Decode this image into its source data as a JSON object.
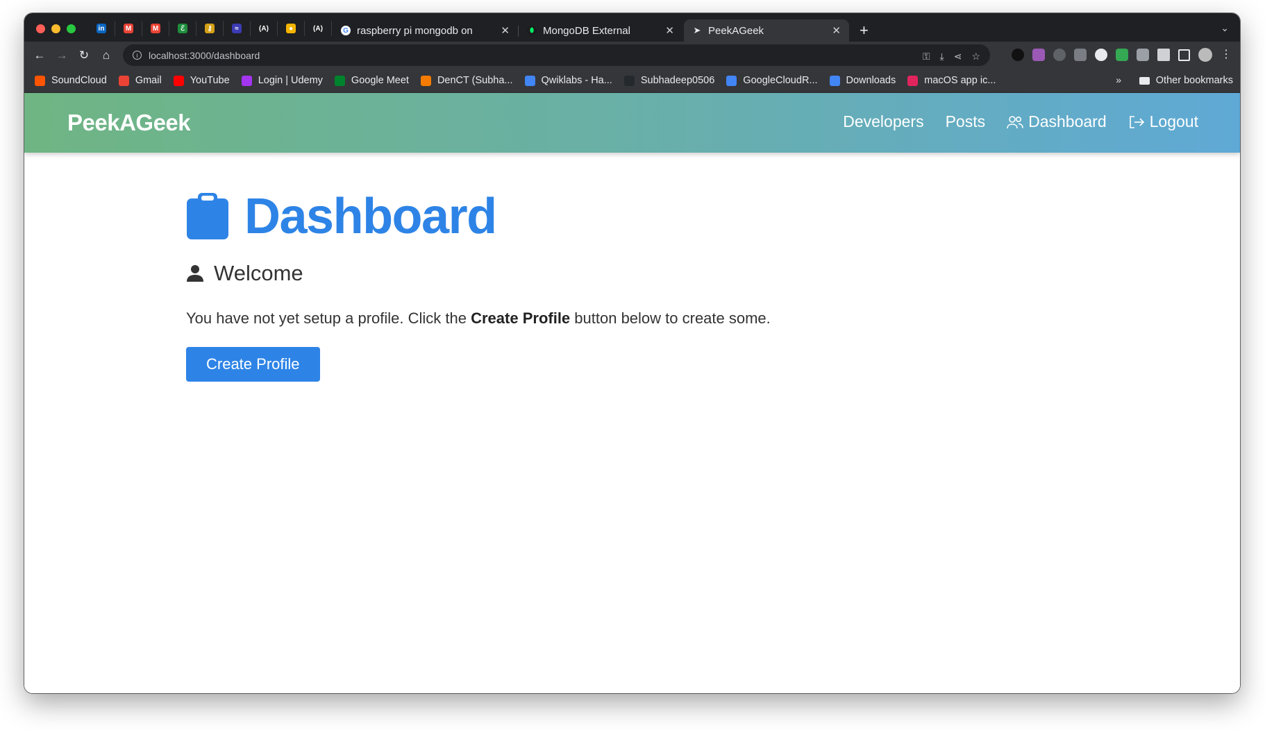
{
  "browser": {
    "traffic_lights": [
      "#ff5f57",
      "#febc2e",
      "#28c840"
    ],
    "pinned_tabs": [
      {
        "icon": "linkedin-icon",
        "glyph": "in",
        "color": "#0a66c2"
      },
      {
        "icon": "gmail-icon",
        "glyph": "M",
        "color": "#ea4335"
      },
      {
        "icon": "gmail-icon",
        "glyph": "M",
        "color": "#ea4335"
      },
      {
        "icon": "leaf-icon",
        "glyph": "ℰ",
        "color": "#1e8e3e"
      },
      {
        "icon": "key-icon",
        "glyph": "⚷",
        "color": "#d4a017"
      },
      {
        "icon": "wave-icon",
        "glyph": "≈",
        "color": "#3b3bb3"
      },
      {
        "icon": "angular-icon",
        "glyph": "(A)",
        "color": "#202124"
      },
      {
        "icon": "mic-icon",
        "glyph": "●",
        "color": "#f4b400"
      },
      {
        "icon": "angular-icon",
        "glyph": "(A)",
        "color": "#202124"
      }
    ],
    "tabs": [
      {
        "title": "raspberry pi mongodb on",
        "icon": "google-icon"
      },
      {
        "title": "MongoDB External",
        "icon": "mongodb-leaf-icon"
      },
      {
        "title": "PeekAGeek",
        "icon": "send-icon"
      }
    ],
    "url": "localhost:3000/dashboard",
    "bookmarks": [
      {
        "label": "SoundCloud",
        "color": "#ff5500"
      },
      {
        "label": "Gmail",
        "color": "#ea4335"
      },
      {
        "label": "YouTube",
        "color": "#ff0000"
      },
      {
        "label": "Login | Udemy",
        "color": "#a435f0"
      },
      {
        "label": "Google Meet",
        "color": "#00832d"
      },
      {
        "label": "DenCT (Subha...",
        "color": "#f57c00"
      },
      {
        "label": "Qwiklabs - Ha...",
        "color": "#4285f4"
      },
      {
        "label": "Subhadeep0506",
        "color": "#24292e"
      },
      {
        "label": "GoogleCloudR...",
        "color": "#4285f4"
      },
      {
        "label": "Downloads",
        "color": "#4285f4"
      },
      {
        "label": "macOS app ic...",
        "color": "#e0245e"
      }
    ],
    "bookmarks_overflow": "»",
    "other_bookmarks": "Other bookmarks"
  },
  "navbar": {
    "brand": "PeekAGeek",
    "links": {
      "developers": "Developers",
      "posts": "Posts",
      "dashboard": "Dashboard",
      "logout": "Logout"
    },
    "gradient": [
      "#6fb583",
      "#5fa9d6"
    ]
  },
  "main": {
    "title": "Dashboard",
    "welcome": "Welcome",
    "message_before": "You have not yet setup a profile. Click the ",
    "message_bold": "Create Profile",
    "message_after": " button below to create some.",
    "create_button": "Create Profile",
    "accent": "#2e84e6"
  }
}
